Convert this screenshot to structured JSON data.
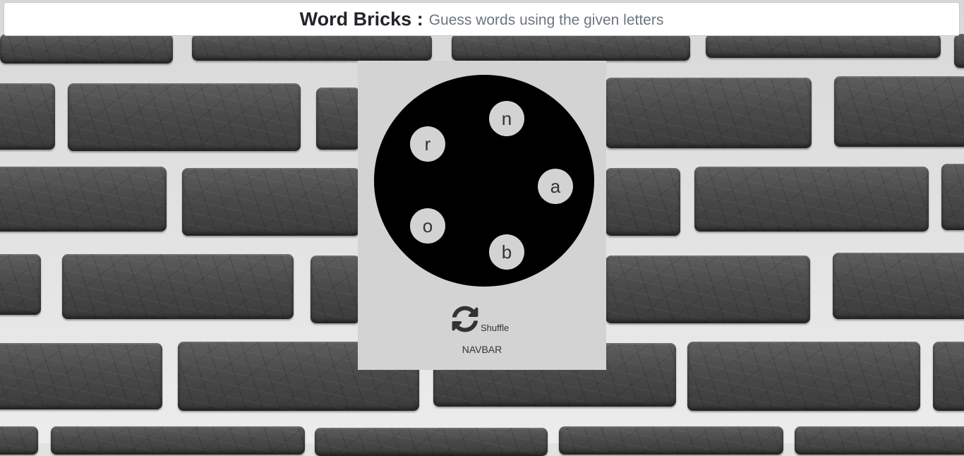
{
  "header": {
    "title": "Word Bricks :",
    "subtitle": "Guess words using the given letters"
  },
  "wheel": {
    "letters": [
      "n",
      "a",
      "b",
      "o",
      "r"
    ]
  },
  "controls": {
    "shuffle_icon": "refresh-icon",
    "shuffle_label": "Shuffle"
  },
  "footer": {
    "navbar_label": "NAVBAR"
  },
  "colors": {
    "panel": "#d3d3d3",
    "wheel": "#000000",
    "letter_tile": "#d3d3d3"
  }
}
